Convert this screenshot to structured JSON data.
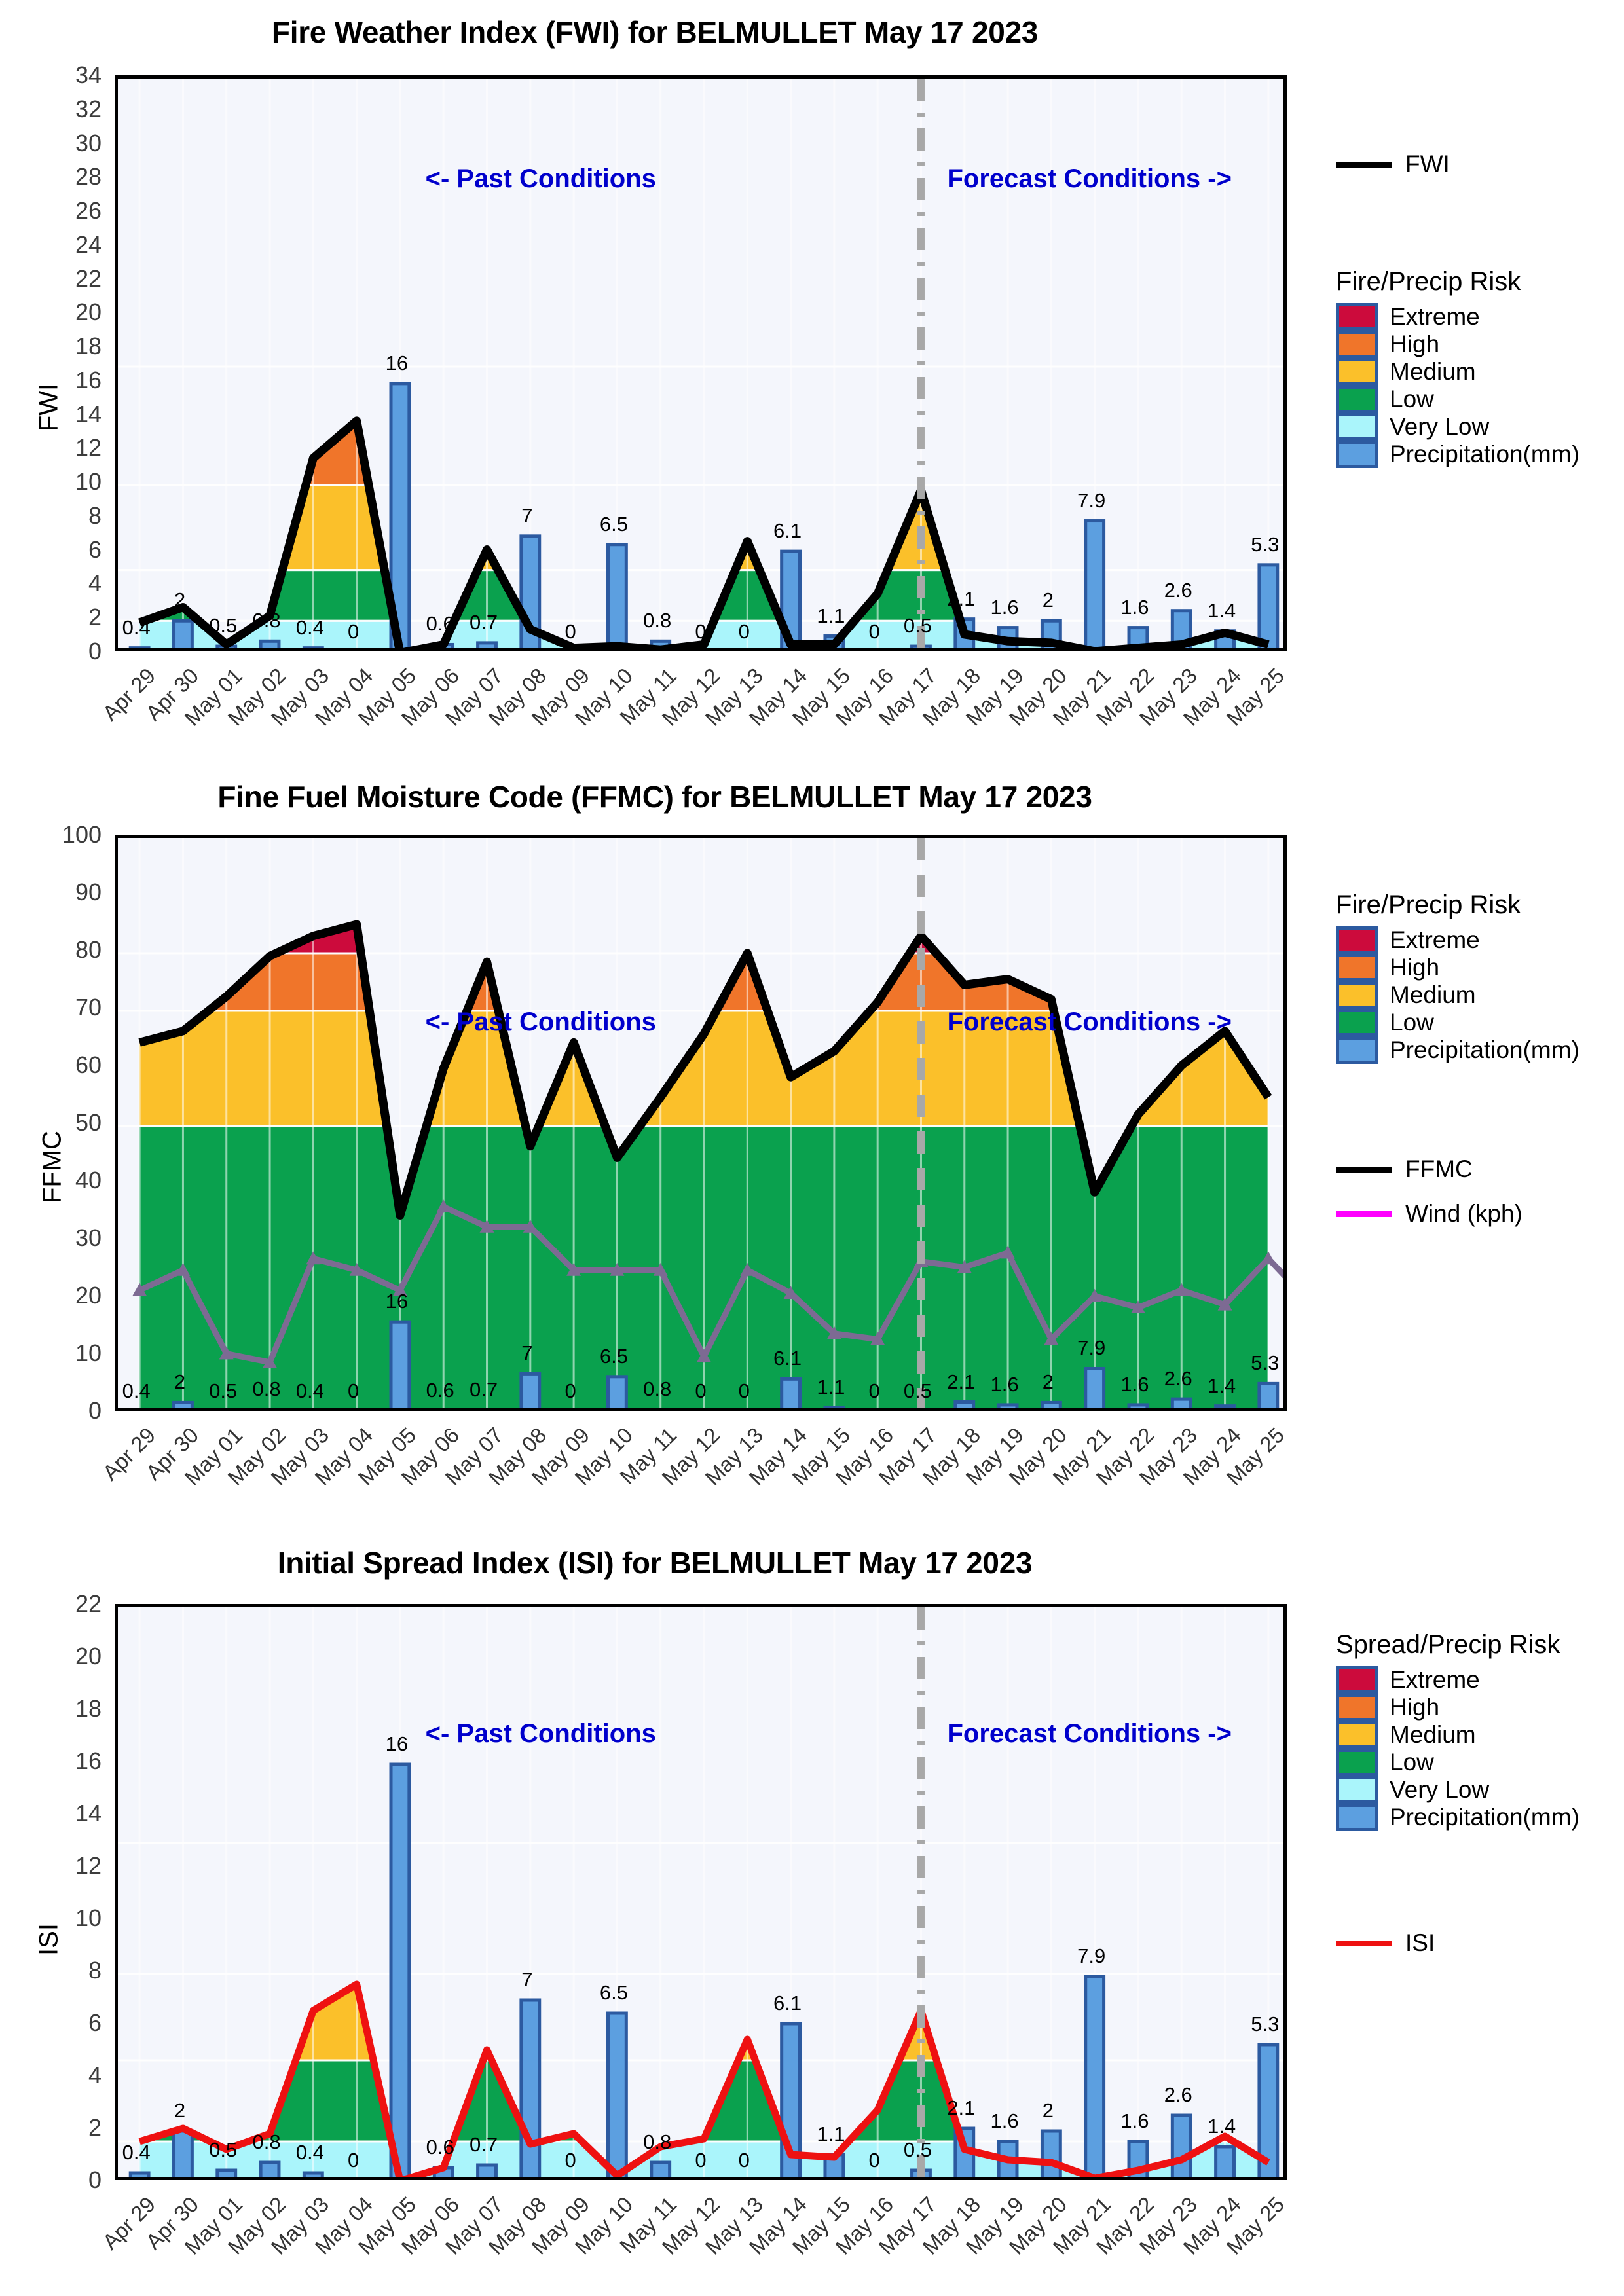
{
  "station": "BELMULLET",
  "report_date": "May 17 2023",
  "annotations": {
    "past": "<- Past Conditions",
    "forecast": "Forecast Conditions ->"
  },
  "colors": {
    "extreme": "#cc0b3c",
    "high": "#f0752a",
    "medium": "#fbc02a",
    "low": "#0aa14e",
    "very_low": "#aaf5fb",
    "precip": "#5c9fe0",
    "precip_edge": "#2c5aa0",
    "fwi_line": "#000000",
    "isi_line": "#ee1111",
    "wind_line": "#7d6a93",
    "plot_bg": "#f4f6fc",
    "annot": "#0000cc",
    "divider": "#a8a8a8"
  },
  "dates": [
    "Apr 29",
    "Apr 30",
    "May 01",
    "May 02",
    "May 03",
    "May 04",
    "May 05",
    "May 06",
    "May 07",
    "May 08",
    "May 09",
    "May 10",
    "May 11",
    "May 12",
    "May 13",
    "May 14",
    "May 15",
    "May 16",
    "May 17",
    "May 18",
    "May 19",
    "May 20",
    "May 21",
    "May 22",
    "May 23",
    "May 24",
    "May 25"
  ],
  "precip_labels": [
    "0.4",
    "2",
    "0.5",
    "0.8",
    "0.4",
    "0",
    "16",
    "0.6",
    "0.7",
    "7",
    "0",
    "6.5",
    "0.8",
    "0",
    "0",
    "6.1",
    "1.1",
    "0",
    "0.5",
    "2.1",
    "1.6",
    "2",
    "7.9",
    "1.6",
    "2.6",
    "1.4",
    "5.3"
  ],
  "forecast_divider_index": 18,
  "charts": [
    {
      "id": "fwi",
      "title": "Fire Weather Index (FWI) for BELMULLET May 17 2023",
      "ylabel": "FWI",
      "legend_title": "Fire/Precip  Risk",
      "line_legend_label": "FWI",
      "legend_items": [
        "Extreme",
        "High",
        "Medium",
        "Low",
        "Very Low",
        "Precipitation(mm)"
      ]
    },
    {
      "id": "ffmc",
      "title": "Fine Fuel Moisture Code (FFMC) for BELMULLET May 17 2023",
      "ylabel": "FFMC",
      "legend_title": "Fire/Precip  Risk",
      "line_legend_label": "FFMC",
      "wind_legend_label": "Wind (kph)",
      "legend_items": [
        "Extreme",
        "High",
        "Medium",
        "Low",
        "Precipitation(mm)"
      ]
    },
    {
      "id": "isi",
      "title": "Initial Spread Index (ISI) for BELMULLET May 17 2023",
      "ylabel": "ISI",
      "legend_title": "Spread/Precip  Risk",
      "line_legend_label": "ISI",
      "legend_items": [
        "Extreme",
        "High",
        "Medium",
        "Low",
        "Very Low",
        "Precipitation(mm)"
      ]
    }
  ],
  "chart_data": [
    {
      "type": "area",
      "id": "fwi",
      "title": "Fire Weather Index (FWI) for BELMULLET May 17 2023",
      "xlabel": "",
      "ylabel": "FWI",
      "ylim": [
        0,
        34
      ],
      "yticks": [
        0,
        2,
        4,
        6,
        8,
        10,
        12,
        14,
        16,
        18,
        20,
        22,
        24,
        26,
        28,
        30,
        32,
        34
      ],
      "grid": true,
      "legend_position": "right",
      "x": [
        "Apr 29",
        "Apr 30",
        "May 01",
        "May 02",
        "May 03",
        "May 04",
        "May 05",
        "May 06",
        "May 07",
        "May 08",
        "May 09",
        "May 10",
        "May 11",
        "May 12",
        "May 13",
        "May 14",
        "May 15",
        "May 16",
        "May 17",
        "May 18",
        "May 19",
        "May 20",
        "May 21",
        "May 22",
        "May 23",
        "May 24",
        "May 25"
      ],
      "series": [
        {
          "name": "FWI",
          "type": "line",
          "color": "#000000",
          "values": [
            1.9,
            2.8,
            0.6,
            2.3,
            11.6,
            13.8,
            0.1,
            0.6,
            6.2,
            1.5,
            0.4,
            0.5,
            0.3,
            0.6,
            6.7,
            0.6,
            0.6,
            3.6,
            9.7,
            1.2,
            0.8,
            0.7,
            0.2,
            0.4,
            0.6,
            1.3,
            0.6
          ]
        },
        {
          "name": "Precipitation(mm)",
          "type": "bar",
          "color": "#5c9fe0",
          "values": [
            0.4,
            2,
            0.5,
            0.8,
            0.4,
            0,
            16,
            0.6,
            0.7,
            7,
            0,
            6.5,
            0.8,
            0,
            0,
            6.1,
            1.1,
            0,
            0.5,
            2.1,
            1.6,
            2,
            7.9,
            1.6,
            2.6,
            1.4,
            5.3
          ]
        }
      ],
      "risk_bands": [
        {
          "label": "Very Low",
          "from": 0,
          "to": 2,
          "color": "#aaf5fb"
        },
        {
          "label": "Low",
          "from": 2,
          "to": 5,
          "color": "#0aa14e"
        },
        {
          "label": "Medium",
          "from": 5,
          "to": 10,
          "color": "#fbc02a"
        },
        {
          "label": "High",
          "from": 10,
          "to": 17,
          "color": "#f0752a"
        },
        {
          "label": "Extreme",
          "from": 17,
          "to": 34,
          "color": "#cc0b3c"
        }
      ],
      "annotations": [
        {
          "text": "<- Past Conditions",
          "x": "May 13"
        },
        {
          "text": "Forecast Conditions ->",
          "x": "May 20"
        }
      ],
      "divider": {
        "x": "May 17",
        "style": "dashdot",
        "color": "#a8a8a8"
      }
    },
    {
      "type": "area",
      "id": "ffmc",
      "title": "Fine Fuel Moisture Code (FFMC) for BELMULLET May 17 2023",
      "xlabel": "",
      "ylabel": "FFMC",
      "ylim": [
        0,
        100
      ],
      "yticks": [
        0,
        10,
        20,
        30,
        40,
        50,
        60,
        70,
        80,
        90,
        100
      ],
      "grid": true,
      "legend_position": "right",
      "x": [
        "Apr 29",
        "Apr 30",
        "May 01",
        "May 02",
        "May 03",
        "May 04",
        "May 05",
        "May 06",
        "May 07",
        "May 08",
        "May 09",
        "May 10",
        "May 11",
        "May 12",
        "May 13",
        "May 14",
        "May 15",
        "May 16",
        "May 17",
        "May 18",
        "May 19",
        "May 20",
        "May 21",
        "May 22",
        "May 23",
        "May 24",
        "May 25"
      ],
      "series": [
        {
          "name": "FFMC",
          "type": "line",
          "color": "#000000",
          "values": [
            64.5,
            66.5,
            72.5,
            79.5,
            83,
            85,
            34.5,
            60,
            78.5,
            46.5,
            64.5,
            44.5,
            55,
            66,
            80,
            58.5,
            63,
            71.5,
            83,
            74.5,
            75.5,
            72,
            38.5,
            52,
            60.5,
            66.5,
            55
          ]
        },
        {
          "name": "Wind (kph)",
          "type": "line",
          "color": "#7d6a93",
          "marker": "triangle",
          "values": [
            21.5,
            25,
            10.5,
            9,
            27,
            25,
            21.5,
            36,
            32.5,
            32.5,
            25,
            25,
            25,
            10,
            25,
            21,
            14,
            13,
            26.5,
            25.5,
            28,
            13,
            20.5,
            18.5,
            21.5,
            19,
            27,
            19
          ]
        },
        {
          "name": "Precipitation(mm)",
          "type": "bar",
          "color": "#5c9fe0",
          "values": [
            0.4,
            2,
            0.5,
            0.8,
            0.4,
            0,
            16,
            0.6,
            0.7,
            7,
            0,
            6.5,
            0.8,
            0,
            0,
            6.1,
            1.1,
            0,
            0.5,
            2.1,
            1.6,
            2,
            7.9,
            1.6,
            2.6,
            1.4,
            5.3
          ]
        }
      ],
      "risk_bands": [
        {
          "label": "Low",
          "from": 0,
          "to": 50,
          "color": "#0aa14e"
        },
        {
          "label": "Medium",
          "from": 50,
          "to": 70,
          "color": "#fbc02a"
        },
        {
          "label": "High",
          "from": 70,
          "to": 80,
          "color": "#f0752a"
        },
        {
          "label": "Extreme",
          "from": 80,
          "to": 100,
          "color": "#cc0b3c"
        }
      ],
      "annotations": [
        {
          "text": "<- Past Conditions",
          "x": "May 13"
        },
        {
          "text": "Forecast Conditions ->",
          "x": "May 20"
        }
      ],
      "divider": {
        "x": "May 17",
        "style": "dashed",
        "color": "#a8a8a8"
      }
    },
    {
      "type": "area",
      "id": "isi",
      "title": "Initial Spread Index (ISI) for BELMULLET May 17 2023",
      "xlabel": "",
      "ylabel": "ISI",
      "ylim": [
        0,
        22
      ],
      "yticks": [
        0,
        2,
        4,
        6,
        8,
        10,
        12,
        14,
        16,
        18,
        20,
        22
      ],
      "grid": true,
      "legend_position": "right",
      "x": [
        "Apr 29",
        "Apr 30",
        "May 01",
        "May 02",
        "May 03",
        "May 04",
        "May 05",
        "May 06",
        "May 07",
        "May 08",
        "May 09",
        "May 10",
        "May 11",
        "May 12",
        "May 13",
        "May 14",
        "May 15",
        "May 16",
        "May 17",
        "May 18",
        "May 19",
        "May 20",
        "May 21",
        "May 22",
        "May 23",
        "May 24",
        "May 25"
      ],
      "series": [
        {
          "name": "ISI",
          "type": "line",
          "color": "#ee1111",
          "values": [
            1.6,
            2.1,
            1.3,
            1.9,
            6.6,
            7.6,
            0.1,
            0.6,
            5.1,
            1.5,
            1.9,
            0.3,
            1.4,
            1.7,
            5.5,
            1.1,
            1.0,
            2.8,
            6.6,
            1.3,
            0.9,
            0.8,
            0.2,
            0.5,
            0.9,
            1.8,
            0.8
          ]
        },
        {
          "name": "Precipitation(mm)",
          "type": "bar",
          "color": "#5c9fe0",
          "values": [
            0.4,
            2,
            0.5,
            0.8,
            0.4,
            0,
            16,
            0.6,
            0.7,
            7,
            0,
            6.5,
            0.8,
            0,
            0,
            6.1,
            1.1,
            0,
            0.5,
            2.1,
            1.6,
            2,
            7.9,
            1.6,
            2.6,
            1.4,
            5.3
          ]
        }
      ],
      "risk_bands": [
        {
          "label": "Very Low",
          "from": 0,
          "to": 1.6,
          "color": "#aaf5fb"
        },
        {
          "label": "Low",
          "from": 1.6,
          "to": 4.7,
          "color": "#0aa14e"
        },
        {
          "label": "Medium",
          "from": 4.7,
          "to": 8,
          "color": "#fbc02a"
        },
        {
          "label": "High",
          "from": 8,
          "to": 13,
          "color": "#f0752a"
        },
        {
          "label": "Extreme",
          "from": 13,
          "to": 22,
          "color": "#cc0b3c"
        }
      ],
      "annotations": [
        {
          "text": "<- Past Conditions",
          "x": "May 13"
        },
        {
          "text": "Forecast Conditions ->",
          "x": "May 20"
        }
      ],
      "divider": {
        "x": "May 17",
        "style": "dashdot",
        "color": "#a8a8a8"
      }
    }
  ]
}
